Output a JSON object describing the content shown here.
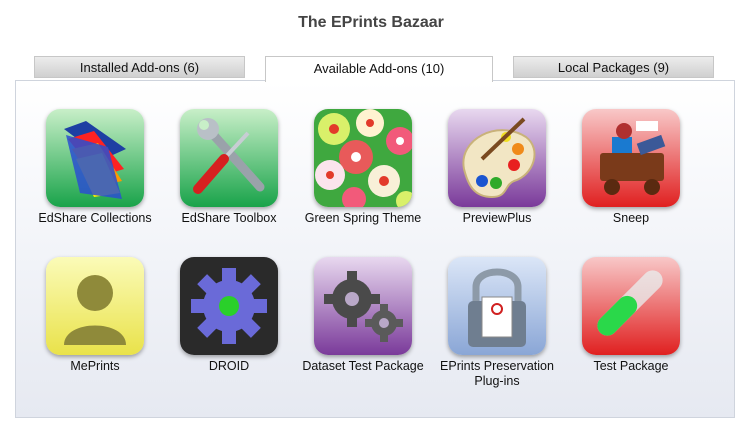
{
  "page": {
    "title": "The EPrints Bazaar"
  },
  "tabs": [
    {
      "label": "Installed Add-ons (6)",
      "active": false
    },
    {
      "label": "Available Add-ons (10)",
      "active": true
    },
    {
      "label": "Local Packages (9)",
      "active": false
    }
  ],
  "addons": [
    {
      "label": "EdShare Collections",
      "icon": "folders-icon"
    },
    {
      "label": "EdShare Toolbox",
      "icon": "wrench-screwdriver-icon"
    },
    {
      "label": "Green Spring Theme",
      "icon": "flower-pattern-icon"
    },
    {
      "label": "PreviewPlus",
      "icon": "paint-palette-icon"
    },
    {
      "label": "Sneep",
      "icon": "social-cart-icon"
    },
    {
      "label": "MePrints",
      "icon": "user-profile-icon"
    },
    {
      "label": "DROID",
      "icon": "gear-icon"
    },
    {
      "label": "Dataset Test Package",
      "icon": "gears-icon"
    },
    {
      "label": "EPrints Preservation Plug-ins",
      "icon": "padlock-pdf-icon"
    },
    {
      "label": "Test Package",
      "icon": "test-tube-icon"
    }
  ]
}
